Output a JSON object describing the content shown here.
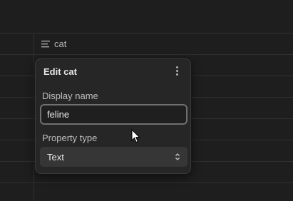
{
  "column": {
    "name": "cat",
    "icon": "text-lines-icon"
  },
  "editor": {
    "title": "Edit cat",
    "menu_icon": "more-vertical-icon",
    "display_name_label": "Display name",
    "display_name_value": "feline",
    "property_type_label": "Property type",
    "property_type_value": "Text",
    "select_icon": "chevron-updown-icon"
  }
}
